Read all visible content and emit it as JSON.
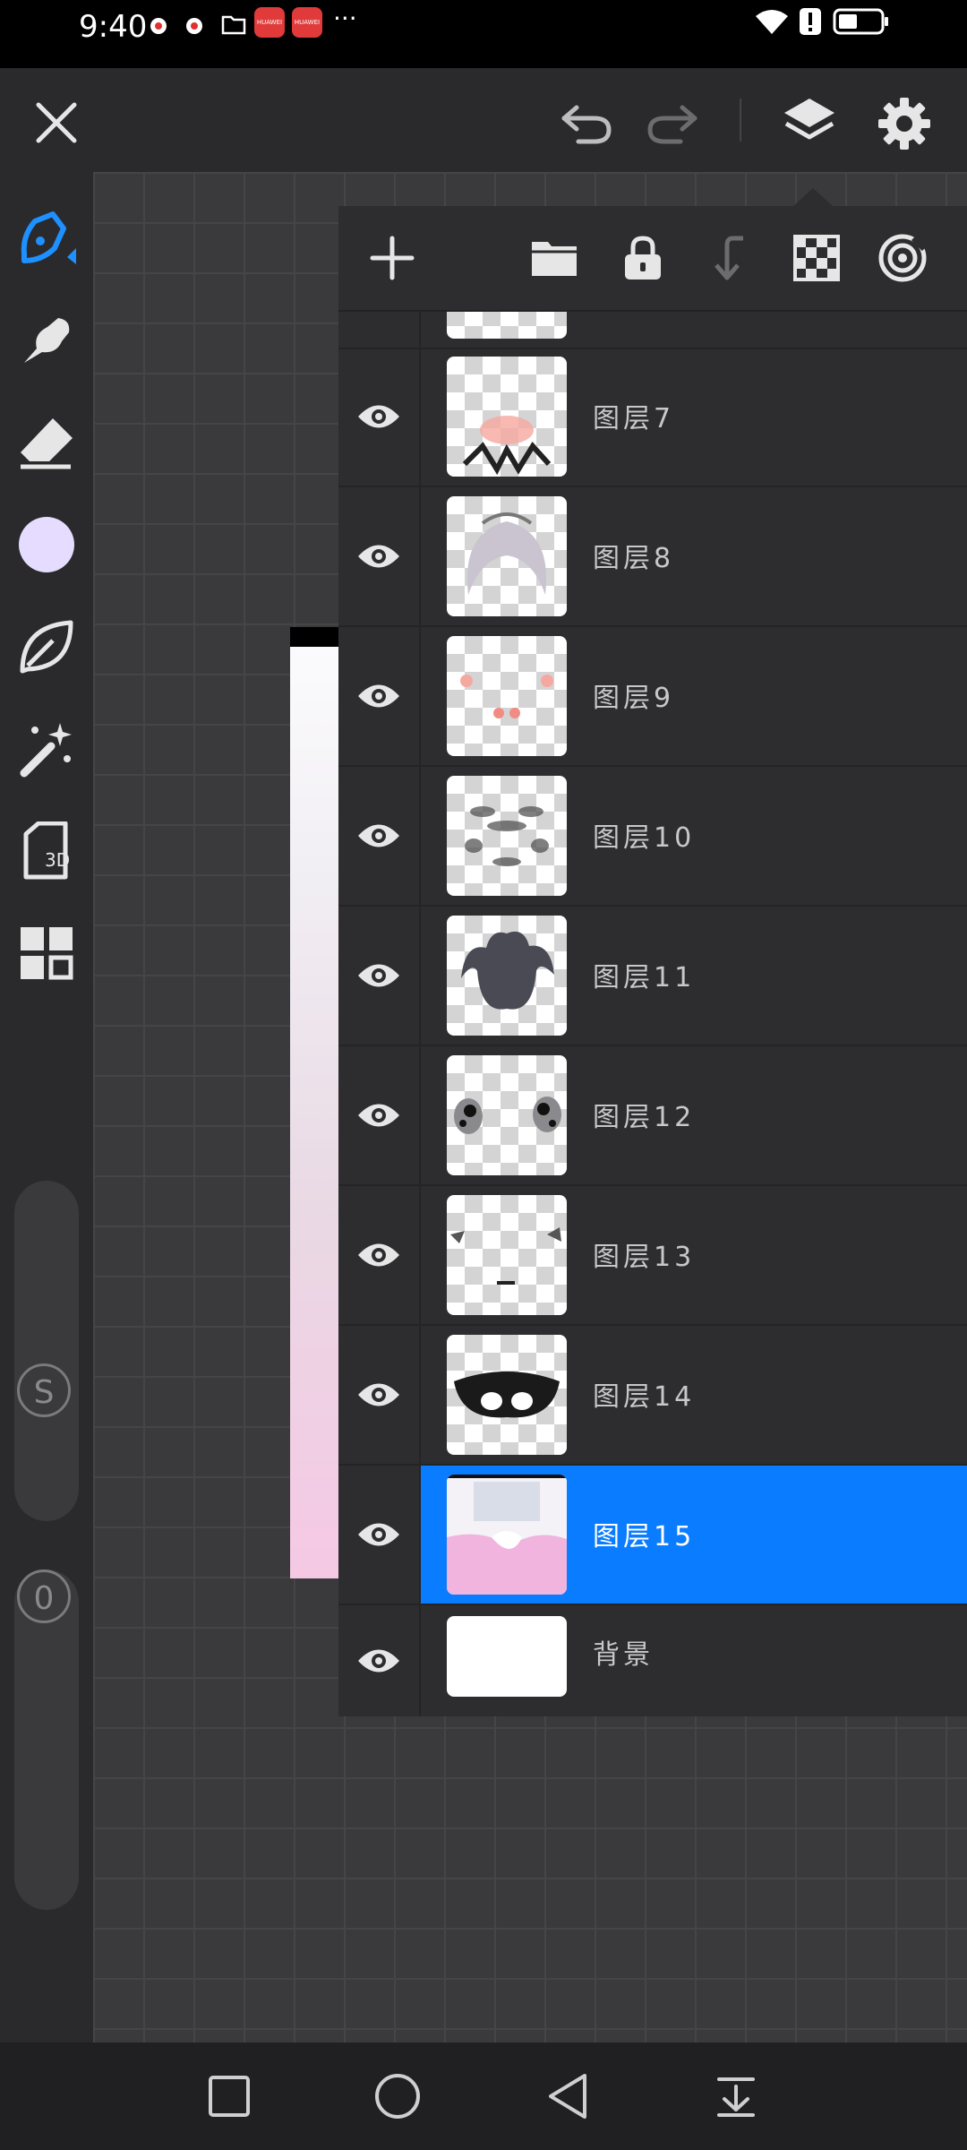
{
  "status_bar": {
    "time": "9:40",
    "app_badge_1": "HUAWEI",
    "app_badge_2": "HUAWEI",
    "more": "···"
  },
  "toolbar": {
    "icons": [
      "close-icon",
      "undo-icon",
      "redo-icon",
      "layers-icon",
      "settings-icon"
    ]
  },
  "sidebar": {
    "tools": [
      "brush-icon",
      "smudge-icon",
      "eraser-icon",
      "color-swatch",
      "leaf-icon",
      "magic-wand-icon",
      "3d-icon",
      "gallery-icon"
    ],
    "color": "#e6dcff",
    "tool_3d_label": "3D",
    "size_slider_label": "S",
    "opacity_slider_label": "0"
  },
  "layers_panel": {
    "toolbar_icons": [
      "add-layer-icon",
      "folder-icon",
      "lock-icon",
      "merge-down-icon",
      "transparency-icon",
      "target-icon"
    ],
    "layers": [
      {
        "name": "图层7"
      },
      {
        "name": "图层8"
      },
      {
        "name": "图层9"
      },
      {
        "name": "图层10"
      },
      {
        "name": "图层11"
      },
      {
        "name": "图层12"
      },
      {
        "name": "图层13"
      },
      {
        "name": "图层14"
      },
      {
        "name": "图层15",
        "selected": true
      },
      {
        "name": "背景"
      }
    ]
  },
  "colors": {
    "accent": "#0a7cff",
    "background": "#2a2a2c"
  },
  "nav_bar": {
    "icons": [
      "recent-apps-icon",
      "home-icon",
      "back-icon",
      "hide-nav-icon"
    ]
  }
}
